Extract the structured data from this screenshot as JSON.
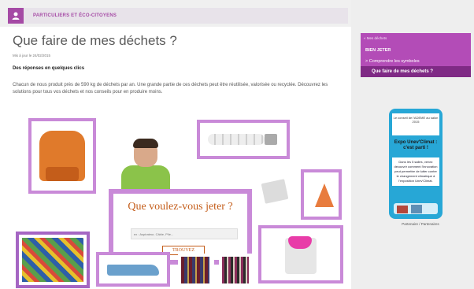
{
  "header": {
    "section_title": "PARTICULIERS ET ÉCO-CITOYENS",
    "user_icon": "user-icon"
  },
  "main": {
    "title": "Que faire de mes déchets ?",
    "updated": "Mis à jour le 24/02/2015",
    "subhead": "Des réponses en quelques clics",
    "intro": "Chacun de nous produit près de 590 kg de déchets par an. Une grande partie de ces déchets peut être réutilisée, valorisée ou recyclée. Découvrez les solutions pour tous vos déchets et nos conseils pour en produire moins.",
    "search": {
      "heading": "Que voulez-vous jeter ?",
      "placeholder": "ex : Aspirateur, Câble, Pile...",
      "button": "TROUVEZ"
    }
  },
  "sidebar": {
    "back": "« Mes déchets",
    "heading": "BIEN JETER",
    "items": [
      {
        "label": "> Comprendre les symboles"
      }
    ],
    "active": "Que faire de mes déchets ?",
    "ad": {
      "top": "Le conseil de l'ADEME au salon 2015",
      "title": "Expo Unev'Climat : c'est parti !",
      "body": "Dans les 5 salles, venez découvrir comment l'innovation peut permettre de lutter contre le changement climatique à l'exposition Unev'Climat.",
      "caption": "Partenaire / Partenaires"
    }
  },
  "colors": {
    "accent": "#b34cb7",
    "accent_dark": "#7f2a85",
    "orange": "#c45d1a"
  }
}
